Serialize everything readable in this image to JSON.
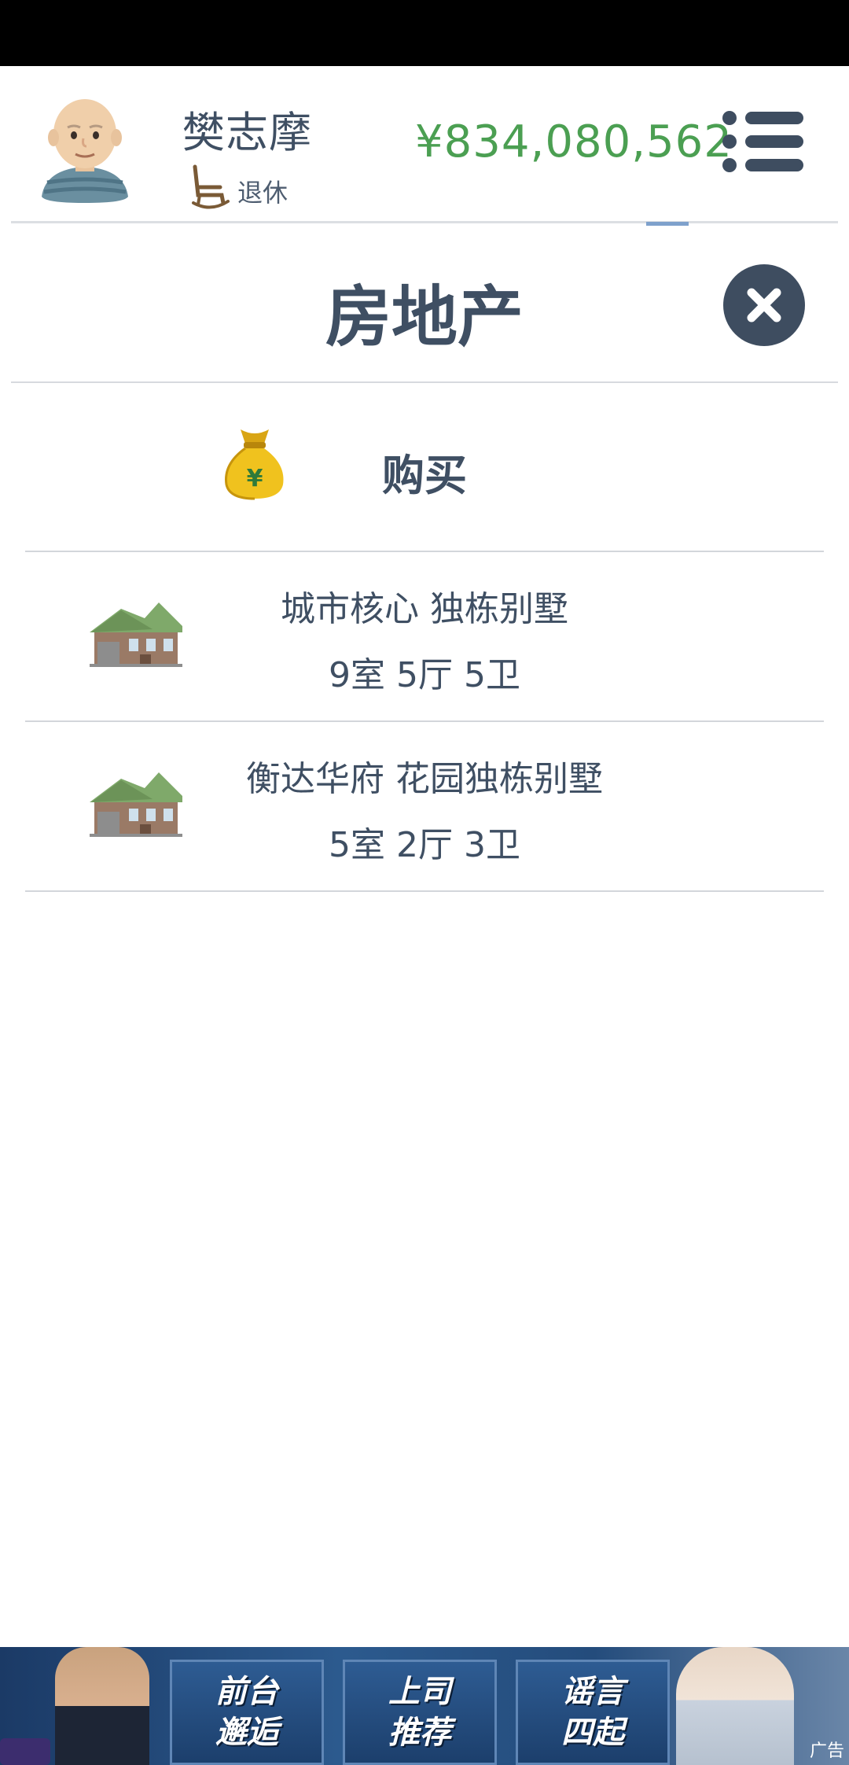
{
  "header": {
    "player_name": "樊志摩",
    "status_text": "退休",
    "money": "¥834,080,562"
  },
  "page": {
    "title": "房地产"
  },
  "buy": {
    "label": "购买"
  },
  "properties": [
    {
      "name": "城市核心 独栋别墅",
      "rooms": "9室 5厅 5卫"
    },
    {
      "name": "衡达华府 花园独栋别墅",
      "rooms": "5室 2厅 3卫"
    }
  ],
  "ad": {
    "buttons": [
      {
        "line1": "前台",
        "line2": "邂逅"
      },
      {
        "line1": "上司",
        "line2": "推荐"
      },
      {
        "line1": "谣言",
        "line2": "四起"
      }
    ],
    "label": "广告"
  },
  "colors": {
    "money_green": "#4b9f52",
    "text_dark": "#3f4f63",
    "close_button": "#3e4d60"
  },
  "icons": [
    "avatar",
    "rocking-chair-icon",
    "menu-icon",
    "close-icon",
    "money-bag-icon",
    "house-icon"
  ]
}
